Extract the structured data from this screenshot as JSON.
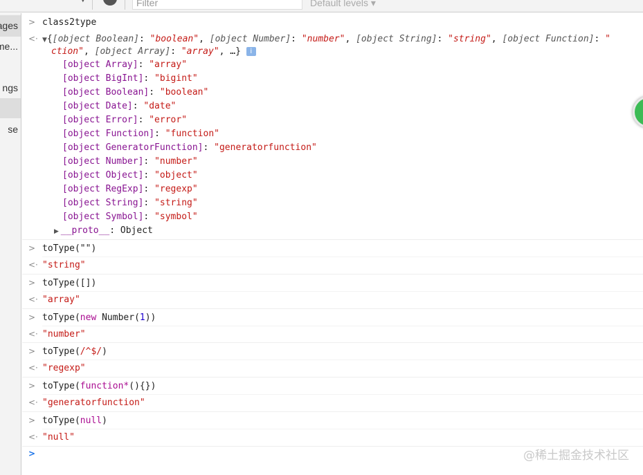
{
  "toolbar": {
    "filter_placeholder": "Filter",
    "levels": "Default levels ▾"
  },
  "sidebar": [
    "ages",
    "me...",
    "ngs",
    "se"
  ],
  "console": {
    "first_input": "class2type",
    "preview_line1": [
      [
        "[object Boolean]",
        "\"boolean\""
      ],
      [
        "[object Number]",
        "\"number\""
      ],
      [
        "[object String]",
        "\"string\""
      ],
      [
        "[object Function]",
        "\""
      ]
    ],
    "preview_line2_start": "ction\"",
    "preview_line2_pair": [
      "[object Array]",
      "\"array\""
    ],
    "preview_ellipsis": ", …}",
    "props": [
      [
        "[object Array]",
        "\"array\""
      ],
      [
        "[object BigInt]",
        "\"bigint\""
      ],
      [
        "[object Boolean]",
        "\"boolean\""
      ],
      [
        "[object Date]",
        "\"date\""
      ],
      [
        "[object Error]",
        "\"error\""
      ],
      [
        "[object Function]",
        "\"function\""
      ],
      [
        "[object GeneratorFunction]",
        "\"generatorfunction\""
      ],
      [
        "[object Number]",
        "\"number\""
      ],
      [
        "[object Object]",
        "\"object\""
      ],
      [
        "[object RegExp]",
        "\"regexp\""
      ],
      [
        "[object String]",
        "\"string\""
      ],
      [
        "[object Symbol]",
        "\"symbol\""
      ]
    ],
    "proto_key": "__proto__",
    "proto_val": "Object",
    "entries": [
      {
        "pre": "toType(\"\")",
        "kw": "",
        "mid": "",
        "post": "",
        "out": "\"string\""
      },
      {
        "pre": "toType([])",
        "kw": "",
        "mid": "",
        "post": "",
        "out": "\"array\""
      },
      {
        "pre": "toType(",
        "kw": "new",
        "mid": " Number(",
        "num": "1",
        "post": "))",
        "out": "\"number\""
      },
      {
        "pre": "toType(",
        "str": "/^$/",
        "post": ")",
        "out": "\"regexp\""
      },
      {
        "pre": "toType(",
        "kw": "function*",
        "mid": "(){}",
        "post": ")",
        "out": "\"generatorfunction\""
      },
      {
        "pre": "toType(",
        "kw": "null",
        "post": ")",
        "out": "\"null\""
      }
    ]
  },
  "watermark": "@稀土掘金技术社区"
}
